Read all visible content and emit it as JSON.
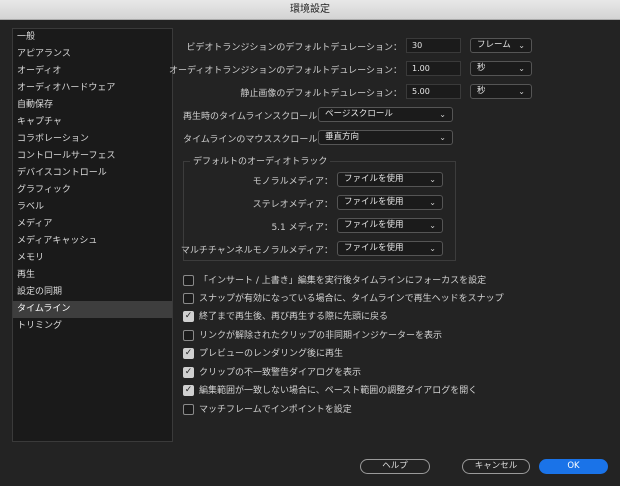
{
  "window": {
    "title": "環境設定"
  },
  "sidebar": {
    "items": [
      "一般",
      "アピアランス",
      "オーディオ",
      "オーディオハードウェア",
      "自動保存",
      "キャプチャ",
      "コラボレーション",
      "コントロールサーフェス",
      "デバイスコントロール",
      "グラフィック",
      "ラベル",
      "メディア",
      "メディアキャッシュ",
      "メモリ",
      "再生",
      "設定の同期",
      "タイムライン",
      "トリミング"
    ],
    "selected": "タイムライン"
  },
  "durations": {
    "video_label": "ビデオトランジションのデフォルトデュレーション：",
    "video_value": "30",
    "video_unit": "フレーム",
    "audio_label": "オーディオトランジションのデフォルトデュレーション：",
    "audio_value": "1.00",
    "audio_unit": "秒",
    "still_label": "静止画像のデフォルトデュレーション：",
    "still_value": "5.00",
    "still_unit": "秒"
  },
  "scroll": {
    "playback_label": "再生時のタイムラインスクロール：",
    "playback_value": "ページスクロール",
    "mouse_label": "タイムラインのマウススクロール：",
    "mouse_value": "垂直方向"
  },
  "audio_tracks": {
    "title": "デフォルトのオーディオトラック",
    "mono_label": "モノラルメディア：",
    "mono_value": "ファイルを使用",
    "stereo_label": "ステレオメディア：",
    "stereo_value": "ファイルを使用",
    "surround_label": "5.1 メディア：",
    "surround_value": "ファイルを使用",
    "multi_label": "マルチチャンネルモノラルメディア：",
    "multi_value": "ファイルを使用"
  },
  "options": [
    {
      "label": "「インサート / 上書き」編集を実行後タイムラインにフォーカスを設定",
      "checked": false
    },
    {
      "label": "スナップが有効になっている場合に、タイムラインで再生ヘッドをスナップ",
      "checked": false
    },
    {
      "label": "終了まで再生後、再び再生する際に先頭に戻る",
      "checked": true
    },
    {
      "label": "リンクが解除されたクリップの非同期インジケーターを表示",
      "checked": false
    },
    {
      "label": "プレビューのレンダリング後に再生",
      "checked": true
    },
    {
      "label": "クリップの不一致警告ダイアログを表示",
      "checked": true
    },
    {
      "label": "編集範囲が一致しない場合に、ペースト範囲の調整ダイアログを開く",
      "checked": true
    },
    {
      "label": "マッチフレームでインポイントを設定",
      "checked": false
    }
  ],
  "buttons": {
    "help": "ヘルプ",
    "cancel": "キャンセル",
    "ok": "OK"
  },
  "icons": {
    "dropdown": "chevron-down-icon",
    "check": "check-icon"
  },
  "colors": {
    "accent": "#1a73e8",
    "background": "#232323",
    "sidebar": "#1a1a1a"
  }
}
